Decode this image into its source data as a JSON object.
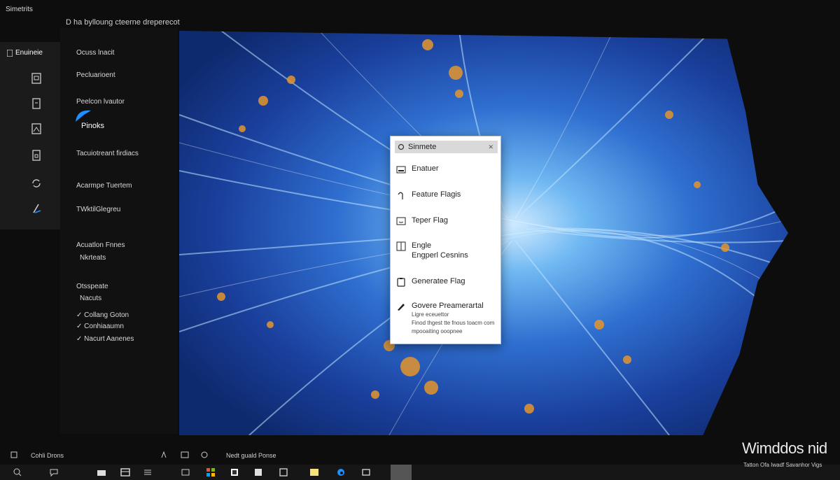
{
  "window": {
    "title": "Simetrits",
    "subtitle": "D ha bylloung cteerne dreperecot"
  },
  "rail": {
    "header": "Enuineie",
    "icons": [
      "document-icon",
      "page-icon",
      "image-icon",
      "lock-page-icon",
      "sync-icon",
      "pen-icon"
    ]
  },
  "panel": {
    "items": [
      "Ocuss lnacit",
      "Pecluarioent",
      "Peelcon lvautor",
      "Pinoks",
      "Tacuiotreant firdiacs",
      "Acarmpe Tuertem",
      "TWktilGlegreu",
      "Acuatlon Fnnes",
      "Nkrteats",
      "Otsspeate",
      "Nacuts",
      "Collang Goton",
      "Conhiaaumn",
      "Nacurt Aanenes"
    ],
    "accent_color": "#1e90ff"
  },
  "menu": {
    "header": "Sinmete",
    "items": [
      {
        "icon": "keyboard-icon",
        "label": "Enatuer"
      },
      {
        "icon": "hook-icon",
        "label": "Feature Flagis"
      },
      {
        "icon": "monitor-icon",
        "label": "Teper Flag"
      },
      {
        "icon": "split-page-icon",
        "label": "Engle",
        "label2": "Engperl Cesnins"
      },
      {
        "icon": "clipboard-icon",
        "label": "Generatee Flag"
      },
      {
        "icon": "pencil-icon",
        "label": "Govere Preamerartal",
        "sub1": "Ligre eceuettor",
        "sub2": "Finod thgest tte fnous toacm com",
        "sub3": "mpooaiting ooopnee"
      }
    ]
  },
  "status": {
    "left": "Cohli Drons",
    "middle": "Nedt guald Ponse"
  },
  "watermark": {
    "title": "Wimddos nid",
    "subtitle": "Tatton Ofa Iwadf Savanhor Vigs"
  }
}
